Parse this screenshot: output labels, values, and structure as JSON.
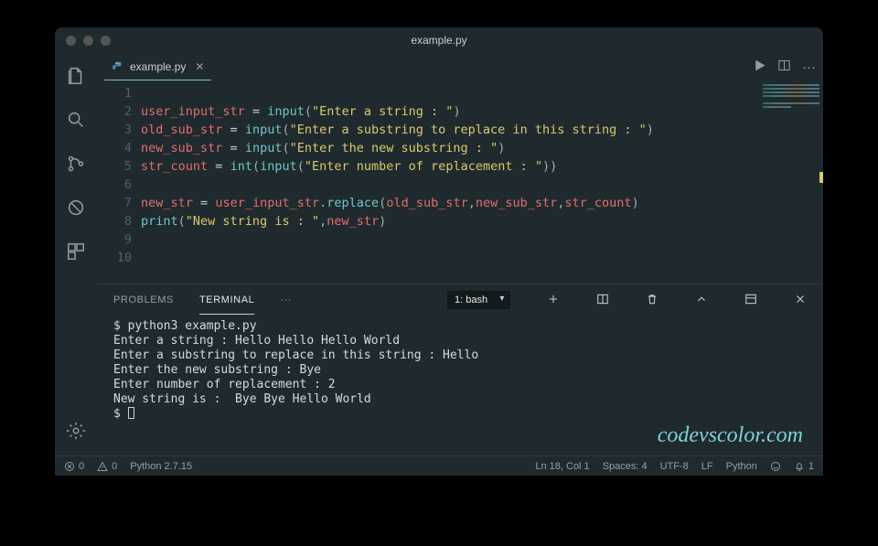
{
  "window": {
    "title": "example.py"
  },
  "tab": {
    "filename": "example.py"
  },
  "code": {
    "lines": [
      "1",
      "2",
      "3",
      "4",
      "5",
      "6",
      "7",
      "8",
      "9",
      "10"
    ],
    "l1": {
      "v": "user_input_str",
      "fn": "input",
      "s": "\"Enter a string : \""
    },
    "l2": {
      "v": "old_sub_str",
      "fn": "input",
      "s": "\"Enter a substring to replace in this string : \""
    },
    "l3": {
      "v": "new_sub_str",
      "fn": "input",
      "s": "\"Enter the new substring : \""
    },
    "l4": {
      "v": "str_count",
      "fn1": "int",
      "fn2": "input",
      "s": "\"Enter number of replacement : \""
    },
    "l6": {
      "v": "new_str",
      "rhs": "user_input_str",
      "m": "replace",
      "a1": "old_sub_str",
      "a2": "new_sub_str",
      "a3": "str_count"
    },
    "l7": {
      "fn": "print",
      "s": "\"New string is : \"",
      "a": "new_str"
    }
  },
  "panel": {
    "problems": "PROBLEMS",
    "terminal": "TERMINAL",
    "more": "···",
    "shell": "1: bash"
  },
  "terminal": {
    "line1": "$ python3 example.py",
    "line2": "Enter a string : Hello Hello Hello World",
    "line3": "Enter a substring to replace in this string : Hello",
    "line4": "Enter the new substring : Bye",
    "line5": "Enter number of replacement : 2",
    "line6": "New string is :  Bye Bye Hello World",
    "prompt": "$ "
  },
  "status": {
    "errors": "0",
    "warnings": "0",
    "python": "Python 2.7.15",
    "pos": "Ln 18, Col 1",
    "spaces": "Spaces: 4",
    "encoding": "UTF-8",
    "eol": "LF",
    "lang": "Python",
    "bell": "1"
  },
  "watermark": "codevscolor.com"
}
